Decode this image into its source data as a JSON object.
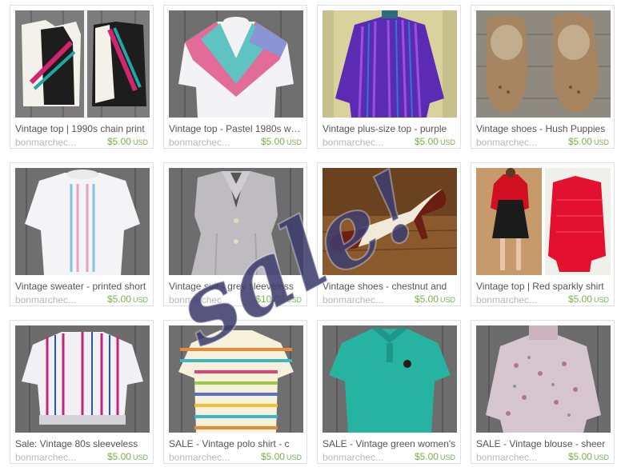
{
  "listings": [
    {
      "title": "Vintage top | 1990s chain print",
      "shop": "bonmarchec...",
      "price": "$5.00",
      "currency": "USD",
      "image": "vest-pair"
    },
    {
      "title": "Vintage top - Pastel 1980s white",
      "shop": "bonmarchec...",
      "price": "$5.00",
      "currency": "USD",
      "image": "pastel-sweatshirt"
    },
    {
      "title": "Vintage plus-size top - purple",
      "shop": "bonmarchec...",
      "price": "$5.00",
      "currency": "USD",
      "image": "purple-top"
    },
    {
      "title": "Vintage shoes - Hush Puppies",
      "shop": "bonmarchec...",
      "price": "$5.00",
      "currency": "USD",
      "image": "tan-shoes"
    },
    {
      "title": "Vintage sweater - printed short",
      "shop": "bonmarchec...",
      "price": "$5.00",
      "currency": "USD",
      "image": "white-sweater"
    },
    {
      "title": "Vintage suit - grey sleeveless",
      "shop": "bonmarchec...",
      "price": "$10.00",
      "currency": "USD",
      "image": "grey-suit"
    },
    {
      "title": "Vintage shoes - chestnut and",
      "shop": "bonmarchec...",
      "price": "$5.00",
      "currency": "USD",
      "image": "heels"
    },
    {
      "title": "Vintage top | Red sparkly shirt",
      "shop": "bonmarchec...",
      "price": "$5.00",
      "currency": "USD",
      "image": "red-top"
    },
    {
      "title": "Sale: Vintage 80s sleeveless",
      "shop": "bonmarchec...",
      "price": "$5.00",
      "currency": "USD",
      "image": "striped-blouse"
    },
    {
      "title": "SALE - Vintage polo shirt - c",
      "shop": "bonmarchec...",
      "price": "$5.00",
      "currency": "USD",
      "image": "rainbow-polo"
    },
    {
      "title": "SALE - Vintage green women's",
      "shop": "bonmarchec...",
      "price": "$5.00",
      "currency": "USD",
      "image": "green-polo"
    },
    {
      "title": "SALE - Vintage blouse - sheer",
      "shop": "bonmarchec...",
      "price": "$5.00",
      "currency": "USD",
      "image": "print-blouse"
    }
  ],
  "overlay": {
    "text": "sale!",
    "color": "#3f3d6e"
  }
}
